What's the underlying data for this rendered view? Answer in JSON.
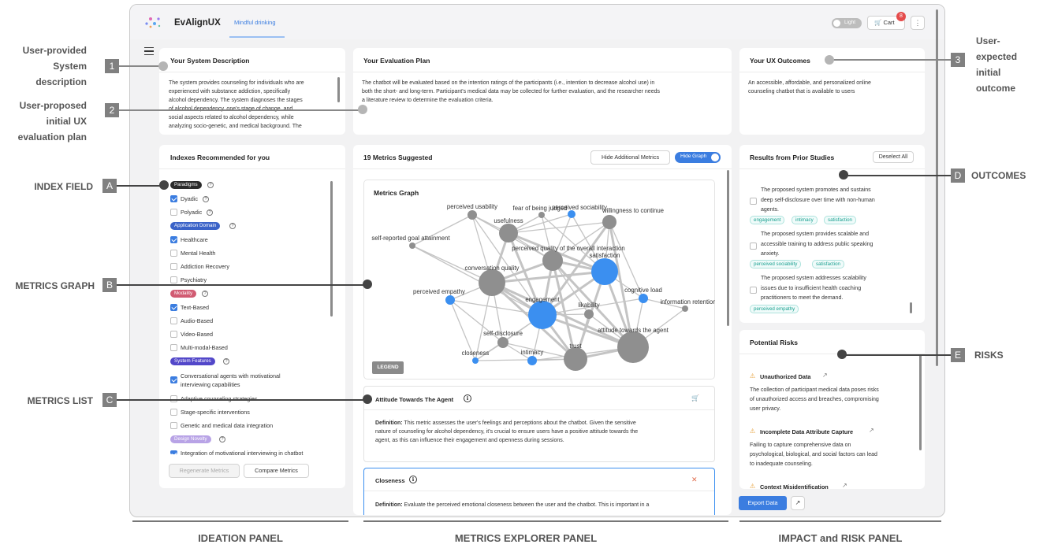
{
  "app": {
    "brand": "EvAlignUX",
    "nav_tab": "Mindful drinking",
    "theme_label": "Light",
    "cart_label": "Cart",
    "cart_count": "8",
    "more_label": "⋮"
  },
  "system_description": {
    "title": "Your System Description",
    "lines": [
      "The system provides counseling for individuals who are",
      "experienced with substance addiction, specifically",
      "alcohol dependency. The system diagnoses the stages",
      "of alcohol dependency, one's stage of change, and",
      "social aspects related to alcohol dependency, while",
      "analyzing socio-genetic, and medical background. The"
    ]
  },
  "evaluation_plan": {
    "title": "Your Evaluation Plan",
    "lines": [
      "The chatbot will be evaluated based on the intention ratings of the participants (i.e., intention to decrease alcohol use) in",
      "both the short- and long-term. Participant's medical data may be collected for further evaluation, and the researcher needs",
      "a literature review to determine the evaluation criteria."
    ]
  },
  "ux_outcomes": {
    "title": "Your UX Outcomes",
    "lines": [
      "An accessible, affordable, and personalized online",
      "counseling chatbot that is available to users"
    ]
  },
  "indexes": {
    "title": "Indexes Recommended for you",
    "tags": {
      "paradigms": "Paradigms",
      "application_domain": "Application Domain",
      "modality": "Modality",
      "system_features": "System Features",
      "design_novelty": "Design Novelty"
    },
    "items": {
      "dyadic": "Dyadic",
      "polyadic": "Polyadic",
      "healthcare": "Healthcare",
      "mental_health": "Mental Health",
      "addiction_recovery": "Addiction Recovery",
      "psychiatry": "Psychiatry",
      "text_based": "Text-Based",
      "audio_based": "Audio-Based",
      "video_based": "Video-Based",
      "multimodal": "Multi-modal-Based",
      "conv_agents_1": "Conversational agents with motivational",
      "conv_agents_2": "interviewing capabilities",
      "adaptive": "Adaptive counseling strategies",
      "stage_specific": "Stage-specific interventions",
      "genetic": "Genetic and medical data integration",
      "integration_mi": "Integration of motivational interviewing in chatbot"
    },
    "regenerate": "Regenerate Metrics",
    "compare": "Compare Metrics"
  },
  "metrics": {
    "title": "19 Metrics Suggested",
    "hide_additional": "Hide Additional Metrics",
    "hide_graph": "Hide Graph",
    "graph_title": "Metrics Graph",
    "legend": "LEGEND",
    "node_labels": [
      "perceived usability",
      "fear of being judged",
      "perceived sociability",
      "willingness to continue",
      "usefulness",
      "self-reported goal attainment",
      "perceived quality of the overall interaction",
      "satisfaction",
      "conversation quality",
      "perceived empathy",
      "cognitive load",
      "information retention",
      "engagement",
      "likability",
      "attitude towards the agent",
      "self-disclosure",
      "trust",
      "closeness",
      "intimacy"
    ],
    "card1": {
      "title": "Attitude Towards The Agent",
      "def_label": "Definition:",
      "def_lines": [
        " This metric assesses the user's feelings and perceptions about the chatbot. Given the sensitive",
        "nature of counseling for alcohol dependency, it's crucial to ensure users have a positive attitude towards the",
        "agent, as this can influence their engagement and openness during sessions."
      ]
    },
    "card2": {
      "title": "Closeness",
      "def_label": "Definition:",
      "def_line": " Evaluate the perceived emotional closeness between the user and the chatbot. This is important in a",
      "close": "✕"
    }
  },
  "prior_studies": {
    "title": "Results from Prior Studies",
    "deselect": "Deselect All",
    "study1": [
      "The proposed system promotes and sustains",
      "deep self-disclosure over time with non-human",
      "agents."
    ],
    "study1_tags": [
      "engagement",
      "intimacy",
      "satisfaction"
    ],
    "study2": [
      "The proposed system provides scalable and",
      "accessible training to address public speaking",
      "anxiety."
    ],
    "study2_tags": [
      "perceived sociability",
      "satisfaction"
    ],
    "study3": [
      "The proposed system addresses scalability",
      "issues due to insufficient health coaching",
      "practitioners to meet the demand."
    ],
    "study3_tags": [
      "perceived empathy"
    ]
  },
  "risks": {
    "title": "Potential Risks",
    "r1_title": "Unauthorized Data",
    "r1_lines": [
      "The collection of participant medical data poses risks",
      "of unauthorized access and breaches, compromising",
      "user privacy."
    ],
    "r2_title": "Incomplete Data Attribute Capture",
    "r2_lines": [
      "Failing to capture comprehensive data on",
      "psychological, biological, and social factors can lead",
      "to inadequate counseling."
    ],
    "r3_title": "Context Misidentification",
    "export": "Export Data"
  },
  "annotations": {
    "n1_lines": [
      "User-provided",
      "System",
      "description"
    ],
    "n1_box": "1",
    "n2_lines": [
      "User-proposed",
      "initial UX",
      "evaluation plan"
    ],
    "n2_box": "2",
    "n3_lines": [
      "User-",
      "expected",
      "initial",
      "outcome"
    ],
    "n3_box": "3",
    "a_label": "INDEX FIELD",
    "a_box": "A",
    "b_label": "METRICS GRAPH",
    "b_box": "B",
    "c_label": "METRICS LIST",
    "c_box": "C",
    "d_label": "OUTCOMES",
    "d_box": "D",
    "e_label": "RISKS",
    "e_box": "E"
  },
  "panels": {
    "ideation": "IDEATION PANEL",
    "explorer": "METRICS EXPLORER PANEL",
    "impact": "IMPACT and RISK PANEL"
  },
  "colors": {
    "accent_blue": "#3b7de0",
    "node_gray": "#8f8f8f",
    "node_blue": "#3b8ff0",
    "annotation_gray": "#808080",
    "tag_paradigms": "#2b2b2b",
    "tag_domain": "#3b63c8",
    "tag_modality": "#d15b72",
    "tag_features": "#5247c9",
    "tag_novelty": "#b8a3e6"
  }
}
